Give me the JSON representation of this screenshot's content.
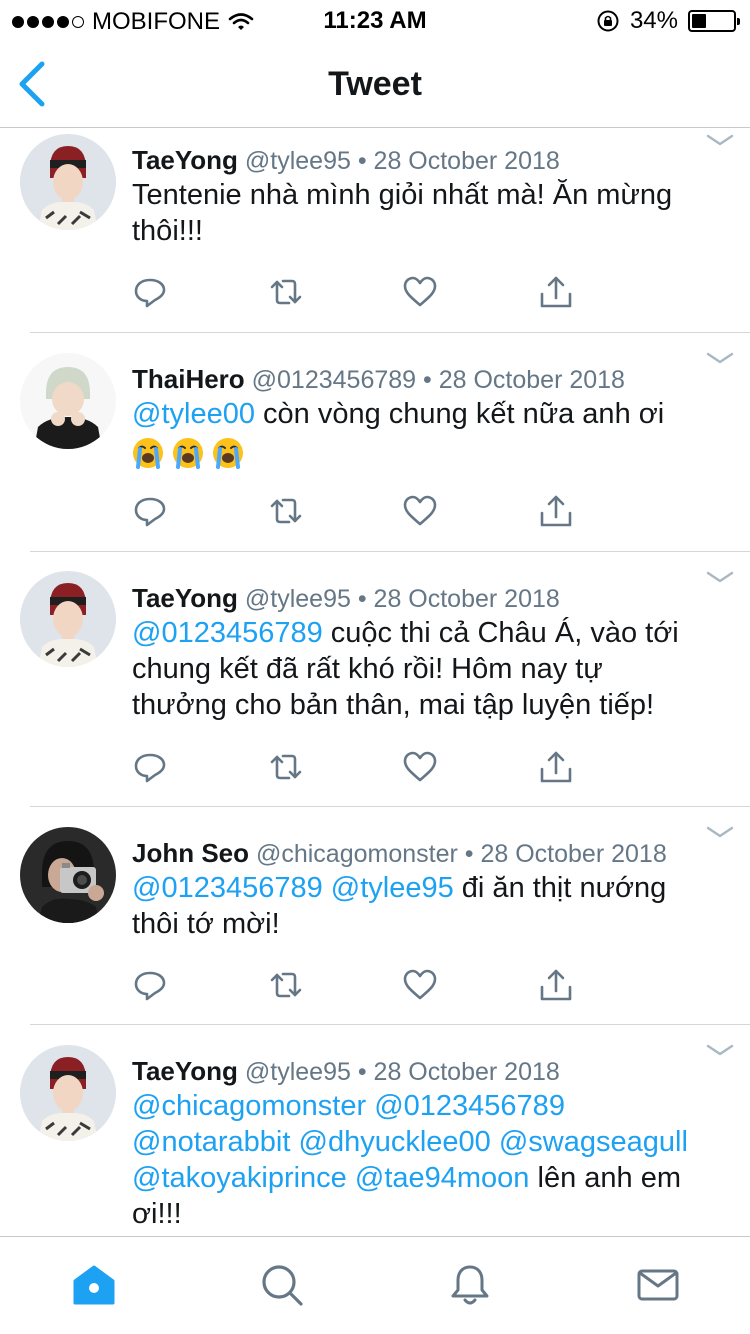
{
  "status_bar": {
    "carrier": "MOBIFONE",
    "time": "11:23 AM",
    "battery": "34%",
    "battery_level": 0.34
  },
  "nav": {
    "title": "Tweet",
    "back_icon": "chevron-left-icon"
  },
  "tweets": [
    {
      "name": "TaeYong",
      "handle": "@tylee95",
      "date": "• 28 October 2018",
      "text_line1": "Tentenie nhà mình giỏi nhất mà! Ăn mừng",
      "text_line2": "thôi!!!"
    },
    {
      "name": "ThaiHero",
      "handle": "@0123456789",
      "date": "• 28 October 2018",
      "mention1": "@tylee00",
      "text_after": " còn vòng chung kết nữa anh ơi",
      "emoji": "loudly-crying-face"
    },
    {
      "name": "TaeYong",
      "handle": "@tylee95",
      "date": "• 28 October 2018",
      "mention1": "@0123456789",
      "text_after": " cuộc thi cả Châu Á, vào tới",
      "text_line2": "chung kết đã rất khó rồi! Hôm nay tự",
      "text_line3": "thưởng cho bản thân, mai tập luyện tiếp!"
    },
    {
      "name": "John Seo",
      "handle": "@chicagomonster",
      "date": "• 28 October 2018",
      "mention1": "@0123456789",
      "mention2": "@tylee95",
      "text_after": " đi ăn thịt nướng",
      "text_line2": "thôi tớ mời!"
    },
    {
      "name": "TaeYong",
      "handle": "@tylee95",
      "date": "• 28 October 2018",
      "mention1": "@chicagomonster",
      "mention2": "@0123456789",
      "mention3": "@notarabbit",
      "mention4": "@dhyucklee00",
      "mention5": "@swagseagull",
      "mention6": "@takoyakiprince",
      "mention7": "@tae94moon",
      "text_after": " lên anh em",
      "text_line_last": "ơi!!!"
    }
  ],
  "colors": {
    "accent": "#1da1f2",
    "icon_gray": "#657786",
    "text": "#14171a"
  },
  "tab_bar": {
    "items": [
      "home-icon",
      "search-icon",
      "notifications-icon",
      "messages-icon"
    ],
    "active": "home-icon"
  }
}
